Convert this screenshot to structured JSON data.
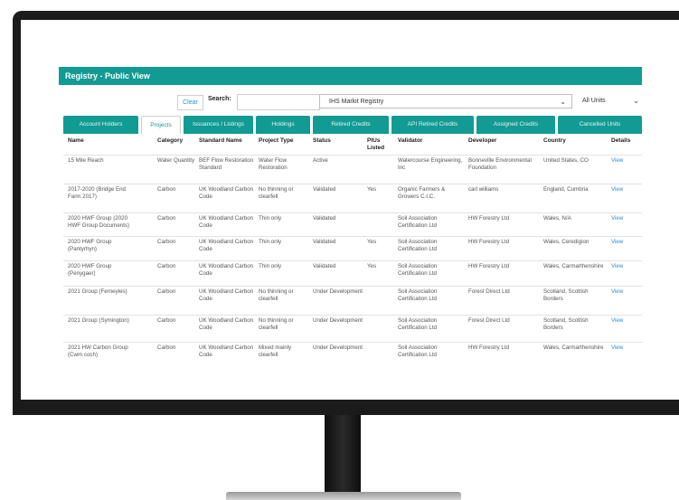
{
  "header": {
    "title": "Registry - Public View"
  },
  "search": {
    "clear_label": "Clear",
    "search_label": "Search:",
    "search_value": "",
    "registry_selected": "IHS Markit Registry",
    "units_selected": "All Units"
  },
  "tabs": [
    {
      "label": "Account Holders"
    },
    {
      "label": "Projects"
    },
    {
      "label": "Issuances / Listings"
    },
    {
      "label": "Holdings"
    },
    {
      "label": "Retired Credits"
    },
    {
      "label": "API Retired Credits"
    },
    {
      "label": "Assigned Credits"
    },
    {
      "label": "Cancelled Units"
    }
  ],
  "table": {
    "columns": [
      "Name",
      "Category",
      "Standard Name",
      "Project Type",
      "Status",
      "PIUs Listed",
      "Validator",
      "Developer",
      "Country",
      "Details"
    ],
    "rows": [
      {
        "name": "15 Mile Reach",
        "category": "Water Quantity",
        "standard": "BEF Flow Restoration Standard",
        "type": "Water Flow Restoration",
        "status": "Active",
        "pius": "",
        "validator": "Watercourse Engineering, Inc",
        "developer": "Bonneville Environmental Foundation",
        "country": "United States, CO",
        "details": "View"
      },
      {
        "name": "2017-2020 (Bridge End Farm 2017)",
        "category": "Carbon",
        "standard": "UK Woodland Carbon Code",
        "type": "No thinning or clearfell",
        "status": "Validated",
        "pius": "Yes",
        "validator": "Organic Farmers & Growers C.I.C.",
        "developer": "carl williams",
        "country": "England, Cumbria",
        "details": "View"
      },
      {
        "name": "2020 HWF Group (2020 HWF Group Documents)",
        "category": "Carbon",
        "standard": "UK Woodland Carbon Code",
        "type": "Thin only",
        "status": "Validated",
        "pius": "",
        "validator": "Soil Association Certification Ltd",
        "developer": "HW Forestry Ltd",
        "country": "Wales, N/A",
        "details": "View"
      },
      {
        "name": "2020 HWF Group (Pantyrhyn)",
        "category": "Carbon",
        "standard": "UK Woodland Carbon Code",
        "type": "Thin only",
        "status": "Validated",
        "pius": "Yes",
        "validator": "Soil Association Certification Ltd",
        "developer": "HW Forestry Ltd",
        "country": "Wales, Ceredigion",
        "details": "View"
      },
      {
        "name": "2020 HWF Group (Penygaer)",
        "category": "Carbon",
        "standard": "UK Woodland Carbon Code",
        "type": "Thin only",
        "status": "Validated",
        "pius": "Yes",
        "validator": "Soil Association Certification Ltd",
        "developer": "HW Forestry Ltd",
        "country": "Wales, Carmarthenshire",
        "details": "View"
      },
      {
        "name": "2021 Group (Ferneyles)",
        "category": "Carbon",
        "standard": "UK Woodland Carbon Code",
        "type": "No thinning or clearfell",
        "status": "Under Development",
        "pius": "",
        "validator": "Soil Association Certification Ltd",
        "developer": "Forest Direct Ltd",
        "country": "Scotland, Scottish Borders",
        "details": "View"
      },
      {
        "name": "2021 Group (Symington)",
        "category": "Carbon",
        "standard": "UK Woodland Carbon Code",
        "type": "No thinning or clearfell",
        "status": "Under Development",
        "pius": "",
        "validator": "Soil Association Certification Ltd",
        "developer": "Forest Direct Ltd",
        "country": "Scotland, Scottish Borders",
        "details": "View"
      },
      {
        "name": "2021 HW Carbon Group (Cwm coch)",
        "category": "Carbon",
        "standard": "UK Woodland Carbon Code",
        "type": "Mixed mainly clearfell",
        "status": "Under Development",
        "pius": "",
        "validator": "Soil Association Certification Ltd",
        "developer": "HW Forestry Ltd",
        "country": "Wales, Carmarthenshire",
        "details": "View"
      }
    ]
  },
  "colors": {
    "accent": "#119b92",
    "link": "#2a8fd0",
    "bezel": "#1b1b1b"
  }
}
